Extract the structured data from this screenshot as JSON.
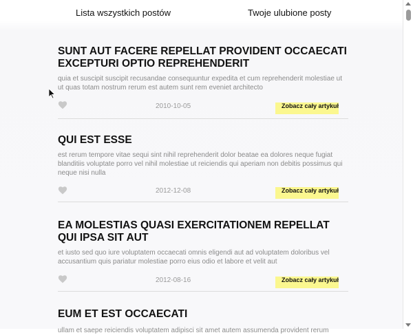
{
  "nav": {
    "tabs": [
      {
        "label": "Lista wszystkich postów"
      },
      {
        "label": "Twoje ulubione posty"
      }
    ]
  },
  "posts": [
    {
      "title": "SUNT AUT FACERE REPELLAT PROVIDENT OCCAECATI EXCEPTURI OPTIO REPREHENDERIT",
      "body": "quia et suscipit suscipit recusandae consequuntur expedita et cum reprehenderit molestiae ut ut quas totam nostrum rerum est autem sunt rem eveniet architecto",
      "date": "2010-10-05",
      "read_more": "Zobacz cały artykuł"
    },
    {
      "title": "QUI EST ESSE",
      "body": "est rerum tempore vitae sequi sint nihil reprehenderit dolor beatae ea dolores neque fugiat blanditiis voluptate porro vel nihil molestiae ut reiciendis qui aperiam non debitis possimus qui neque nisi nulla",
      "date": "2012-12-08",
      "read_more": "Zobacz cały artykuł"
    },
    {
      "title": "EA MOLESTIAS QUASI EXERCITATIONEM REPELLAT QUI IPSA SIT AUT",
      "body": "et iusto sed quo iure voluptatem occaecati omnis eligendi aut ad voluptatem doloribus vel accusantium quis pariatur molestiae porro eius odio et labore et velit aut",
      "date": "2012-08-16",
      "read_more": "Zobacz cały artykuł"
    },
    {
      "title": "EUM ET EST OCCAECATI",
      "body": "ullam et saepe reiciendis voluptatem adipisci sit amet autem assumenda provident rerum",
      "date": "",
      "read_more": ""
    }
  ],
  "colors": {
    "highlight": "#fbf78f",
    "heart": "#c9c9c9",
    "muted_text": "#8a8a8a"
  },
  "icons": {
    "favorite": "heart-icon"
  }
}
